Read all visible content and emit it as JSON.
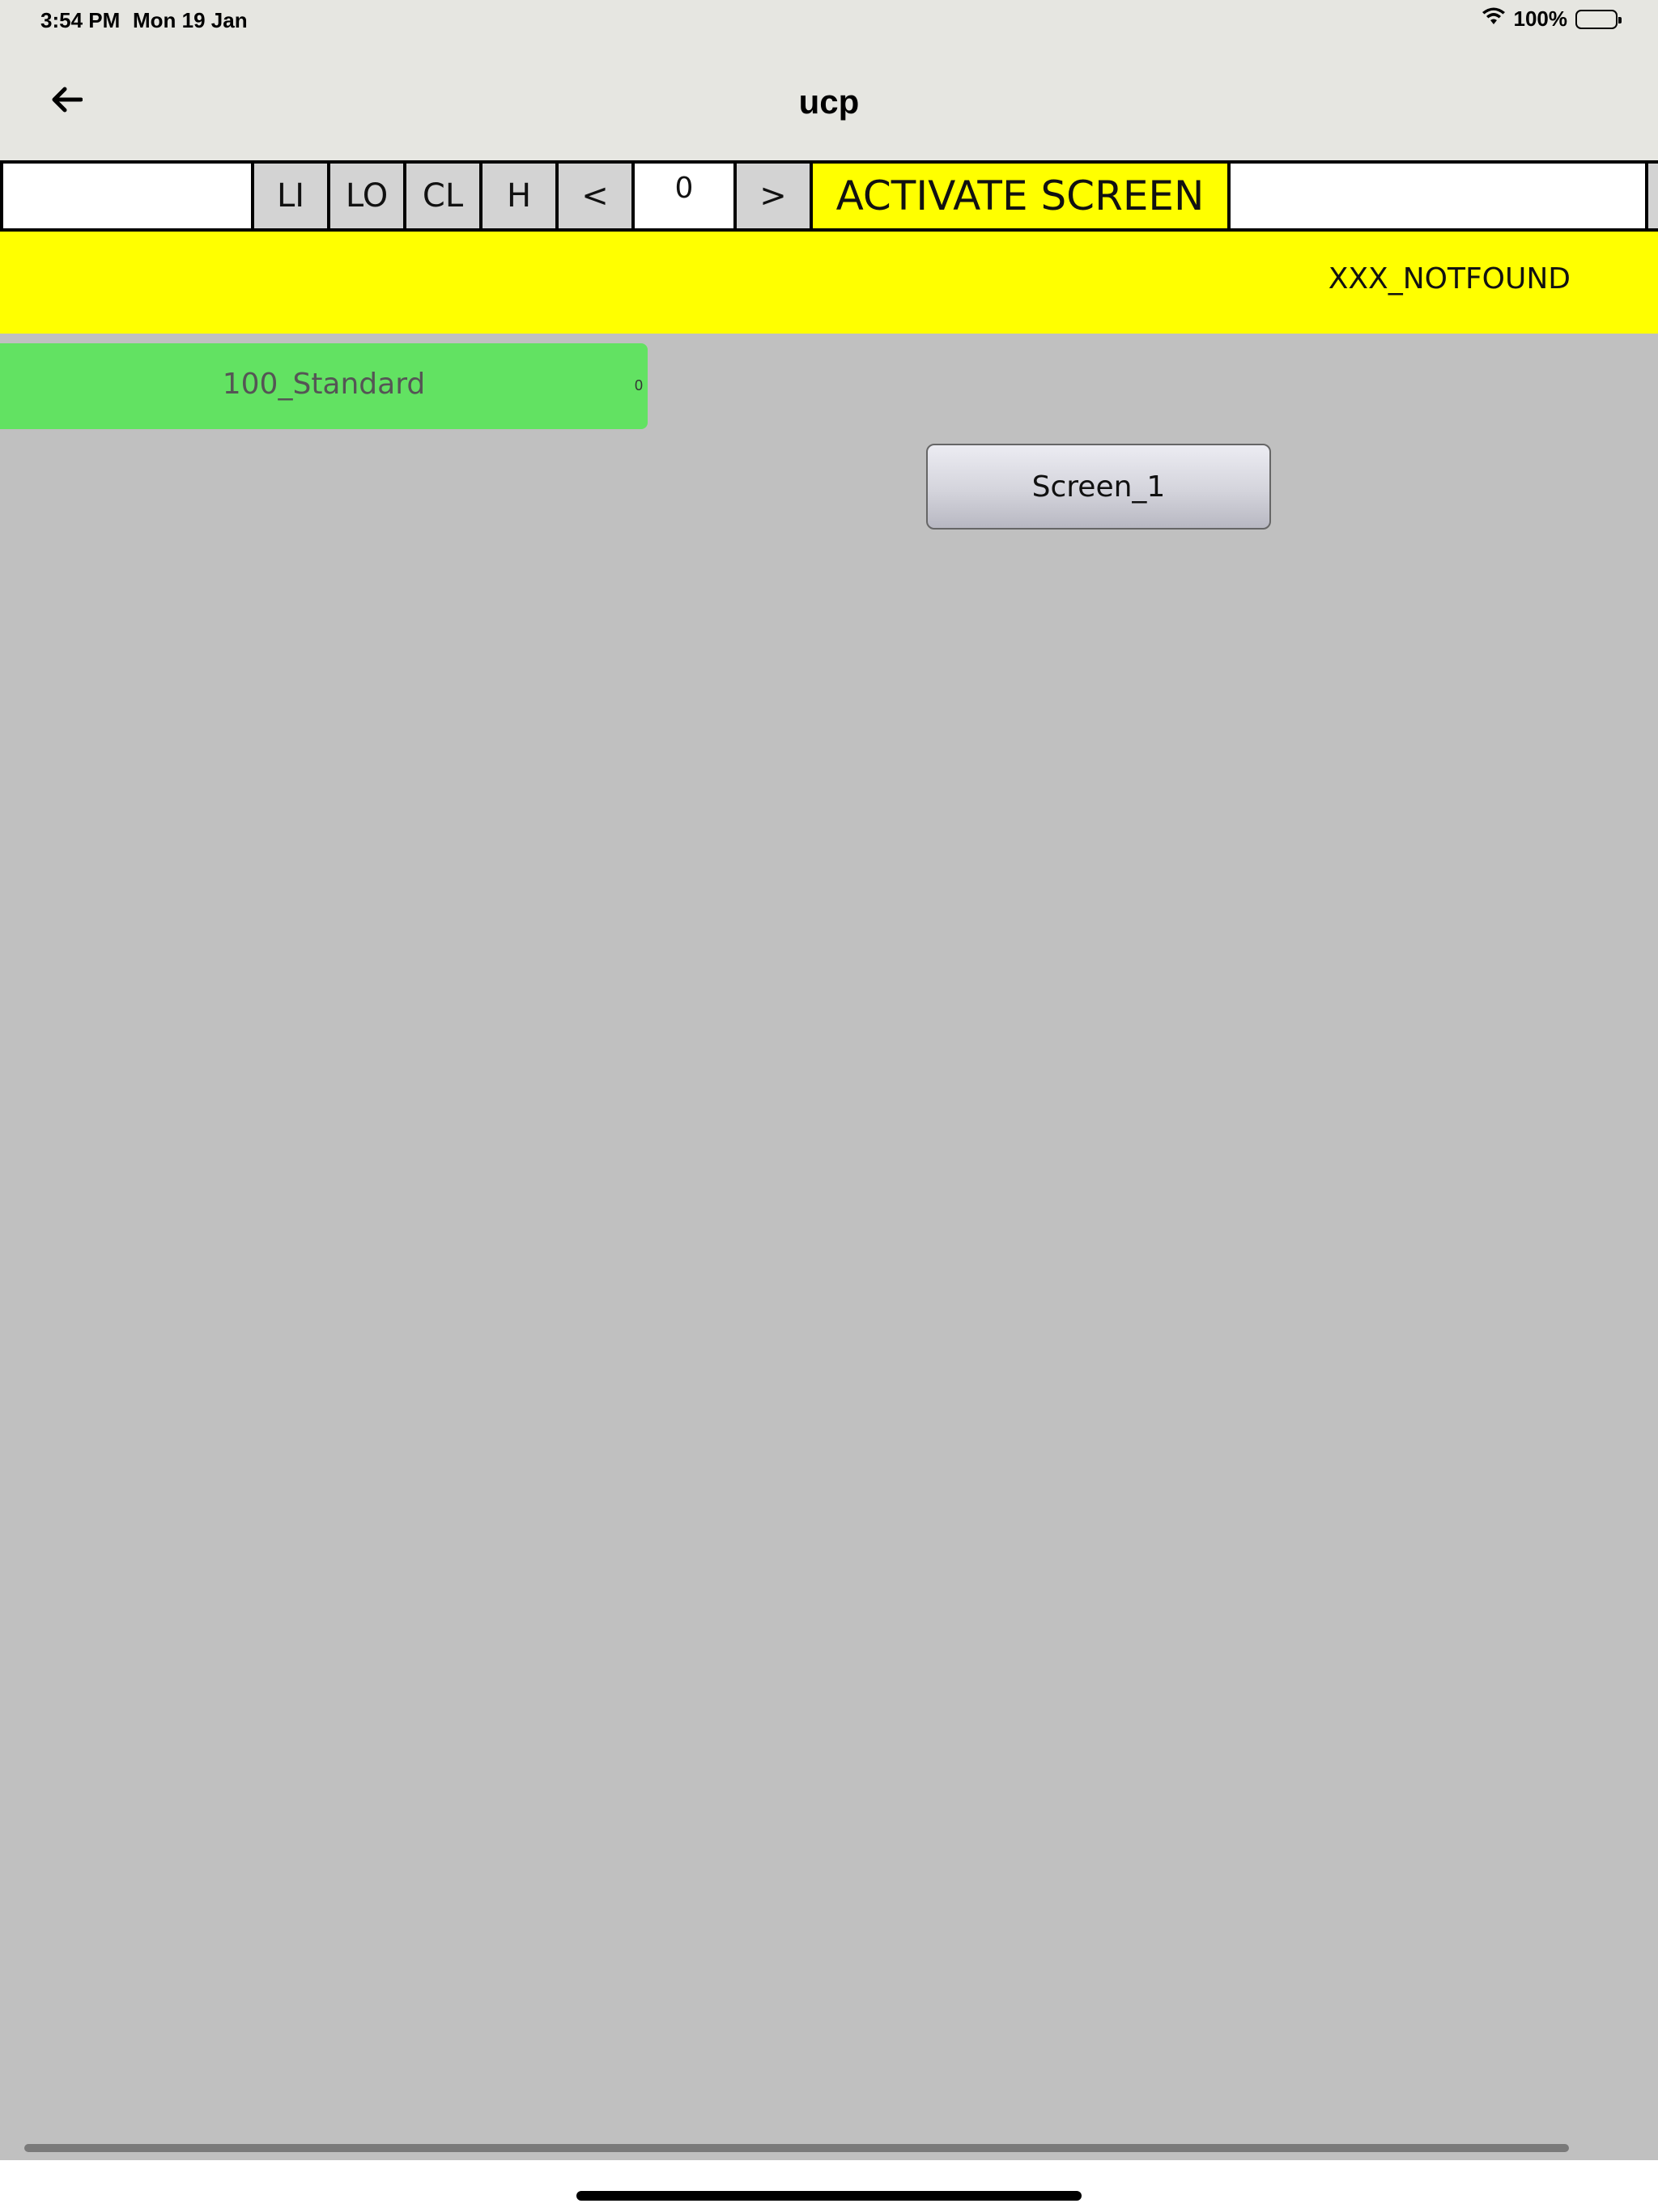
{
  "status_bar": {
    "time": "3:54 PM",
    "date": "Mon 19 Jan",
    "battery": "100%",
    "wifi_icon": "wifi-icon",
    "battery_icon": "battery-icon"
  },
  "nav": {
    "title": "ucp",
    "back_icon": "arrow-left-icon"
  },
  "toolbar": {
    "left_field": "",
    "li_label": "LI",
    "lo_label": "LO",
    "cl_label": "CL",
    "h_label": "H",
    "prev_label": "<",
    "counter": "0",
    "next_label": ">",
    "activate_label": "ACTIVATE SCREEN",
    "right_field": ""
  },
  "banner": {
    "text": "XXX_NOTFOUND"
  },
  "items": [
    {
      "label": "100_Standard",
      "count": "0"
    }
  ],
  "screen_button": {
    "label": "Screen_1"
  },
  "colors": {
    "background": "#c0c0c0",
    "banner": "#ffff00",
    "item_green": "#62e262",
    "nav_bar": "#e6e6e1"
  }
}
